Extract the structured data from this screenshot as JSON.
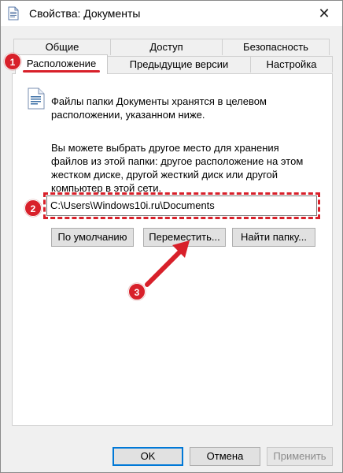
{
  "window": {
    "title": "Свойства: Документы",
    "close_glyph": "✕"
  },
  "tabs": {
    "row1": [
      "Общие",
      "Доступ",
      "Безопасность"
    ],
    "row2": [
      "Расположение",
      "Предыдущие версии",
      "Настройка"
    ],
    "active": "Расположение"
  },
  "location": {
    "info_line1": "Файлы папки Документы хранятся в целевом",
    "info_line2": "расположении, указанном ниже.",
    "desc_line1": "Вы можете выбрать другое место для хранения",
    "desc_line2": "файлов из этой папки: другое расположение на этом",
    "desc_line3": "жестком диске, другой жесткий диск или другой",
    "desc_line4": "компьютер в этой сети.",
    "path_value": "C:\\Users\\Windows10i.ru\\Documents"
  },
  "buttons": {
    "default": "По умолчанию",
    "move": "Переместить...",
    "find": "Найти папку...",
    "ok": "OK",
    "cancel": "Отмена",
    "apply": "Применить"
  },
  "annotations": {
    "step1": "1",
    "step2": "2",
    "step3": "3",
    "color": "#d8202a"
  },
  "icons": {
    "title": "document-icon",
    "folder_info": "document-icon",
    "close": "close-icon"
  }
}
